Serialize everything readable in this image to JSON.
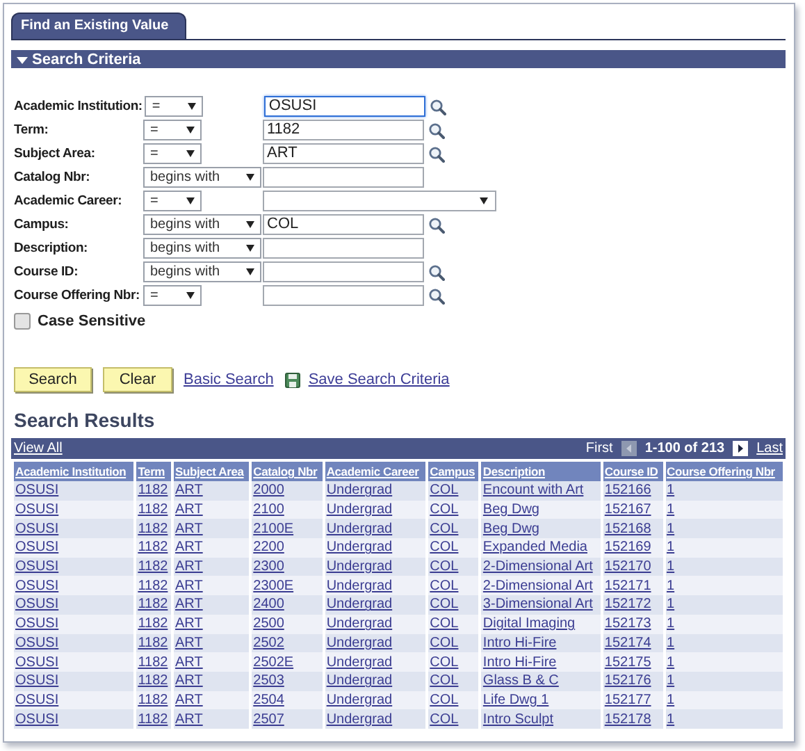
{
  "tab": {
    "label": "Find an Existing Value",
    "selected": true
  },
  "section": {
    "title": "Search Criteria",
    "expanded": true
  },
  "fields": [
    {
      "label": "Academic Institution:",
      "operator": "=",
      "value": "OSUSI",
      "kind": "lookup",
      "focused": true
    },
    {
      "label": "Term:",
      "operator": "=",
      "value": "1182",
      "kind": "lookup",
      "focused": false
    },
    {
      "label": "Subject Area:",
      "operator": "=",
      "value": "ART",
      "kind": "lookup",
      "focused": false
    },
    {
      "label": "Catalog Nbr:",
      "operator": "begins with",
      "kind": "text",
      "focused": false
    },
    {
      "label": "Academic Career:",
      "operator": "=",
      "kind": "dropdown",
      "focused": false
    },
    {
      "label": "Campus:",
      "operator": "begins with",
      "value": "COL",
      "kind": "lookup",
      "focused": false
    },
    {
      "label": "Description:",
      "operator": "begins with",
      "kind": "text",
      "focused": false
    },
    {
      "label": "Course ID:",
      "operator": "begins with",
      "kind": "lookup",
      "focused": false
    },
    {
      "label": "Course Offering Nbr:",
      "operator": "=",
      "kind": "lookup",
      "focused": false
    }
  ],
  "case_sensitive": {
    "label": "Case Sensitive",
    "checked": false
  },
  "actions": [
    {
      "label": "Search",
      "kind": "button"
    },
    {
      "label": "Clear",
      "kind": "button"
    },
    {
      "label": "Basic Search",
      "kind": "link"
    },
    {
      "label": "Save Search Criteria",
      "kind": "save-link"
    }
  ],
  "results": {
    "title": "Search Results",
    "view_all": "View All",
    "first": "First",
    "range": "1-100 of 213",
    "last": "Last",
    "prev_disabled": true,
    "next_disabled": false,
    "columns": [
      "Academic Institution",
      "Term",
      "Subject Area",
      "Catalog Nbr",
      "Academic Career",
      "Campus",
      "Description",
      "Course ID",
      "Course Offering Nbr"
    ],
    "rows": [
      [
        "OSUSI",
        "1182",
        "ART",
        "2000",
        "Undergrad",
        "COL",
        "Encount with Art",
        "152166",
        "1"
      ],
      [
        "OSUSI",
        "1182",
        "ART",
        "2100",
        "Undergrad",
        "COL",
        "Beg Dwg",
        "152167",
        "1"
      ],
      [
        "OSUSI",
        "1182",
        "ART",
        "2100E",
        "Undergrad",
        "COL",
        "Beg Dwg",
        "152168",
        "1"
      ],
      [
        "OSUSI",
        "1182",
        "ART",
        "2200",
        "Undergrad",
        "COL",
        "Expanded Media",
        "152169",
        "1"
      ],
      [
        "OSUSI",
        "1182",
        "ART",
        "2300",
        "Undergrad",
        "COL",
        "2-Dimensional Art",
        "152170",
        "1"
      ],
      [
        "OSUSI",
        "1182",
        "ART",
        "2300E",
        "Undergrad",
        "COL",
        "2-Dimensional Art",
        "152171",
        "1"
      ],
      [
        "OSUSI",
        "1182",
        "ART",
        "2400",
        "Undergrad",
        "COL",
        "3-Dimensional Art",
        "152172",
        "1"
      ],
      [
        "OSUSI",
        "1182",
        "ART",
        "2500",
        "Undergrad",
        "COL",
        "Digital Imaging",
        "152173",
        "1"
      ],
      [
        "OSUSI",
        "1182",
        "ART",
        "2502",
        "Undergrad",
        "COL",
        "Intro Hi-Fire",
        "152174",
        "1"
      ],
      [
        "OSUSI",
        "1182",
        "ART",
        "2502E",
        "Undergrad",
        "COL",
        "Intro Hi-Fire",
        "152175",
        "1"
      ],
      [
        "OSUSI",
        "1182",
        "ART",
        "2503",
        "Undergrad",
        "COL",
        "Glass B & C",
        "152176",
        "1"
      ],
      [
        "OSUSI",
        "1182",
        "ART",
        "2504",
        "Undergrad",
        "COL",
        "Life Dwg 1",
        "152177",
        "1"
      ],
      [
        "OSUSI",
        "1182",
        "ART",
        "2507",
        "Undergrad",
        "COL",
        "Intro Sculpt",
        "152178",
        "1"
      ]
    ]
  }
}
